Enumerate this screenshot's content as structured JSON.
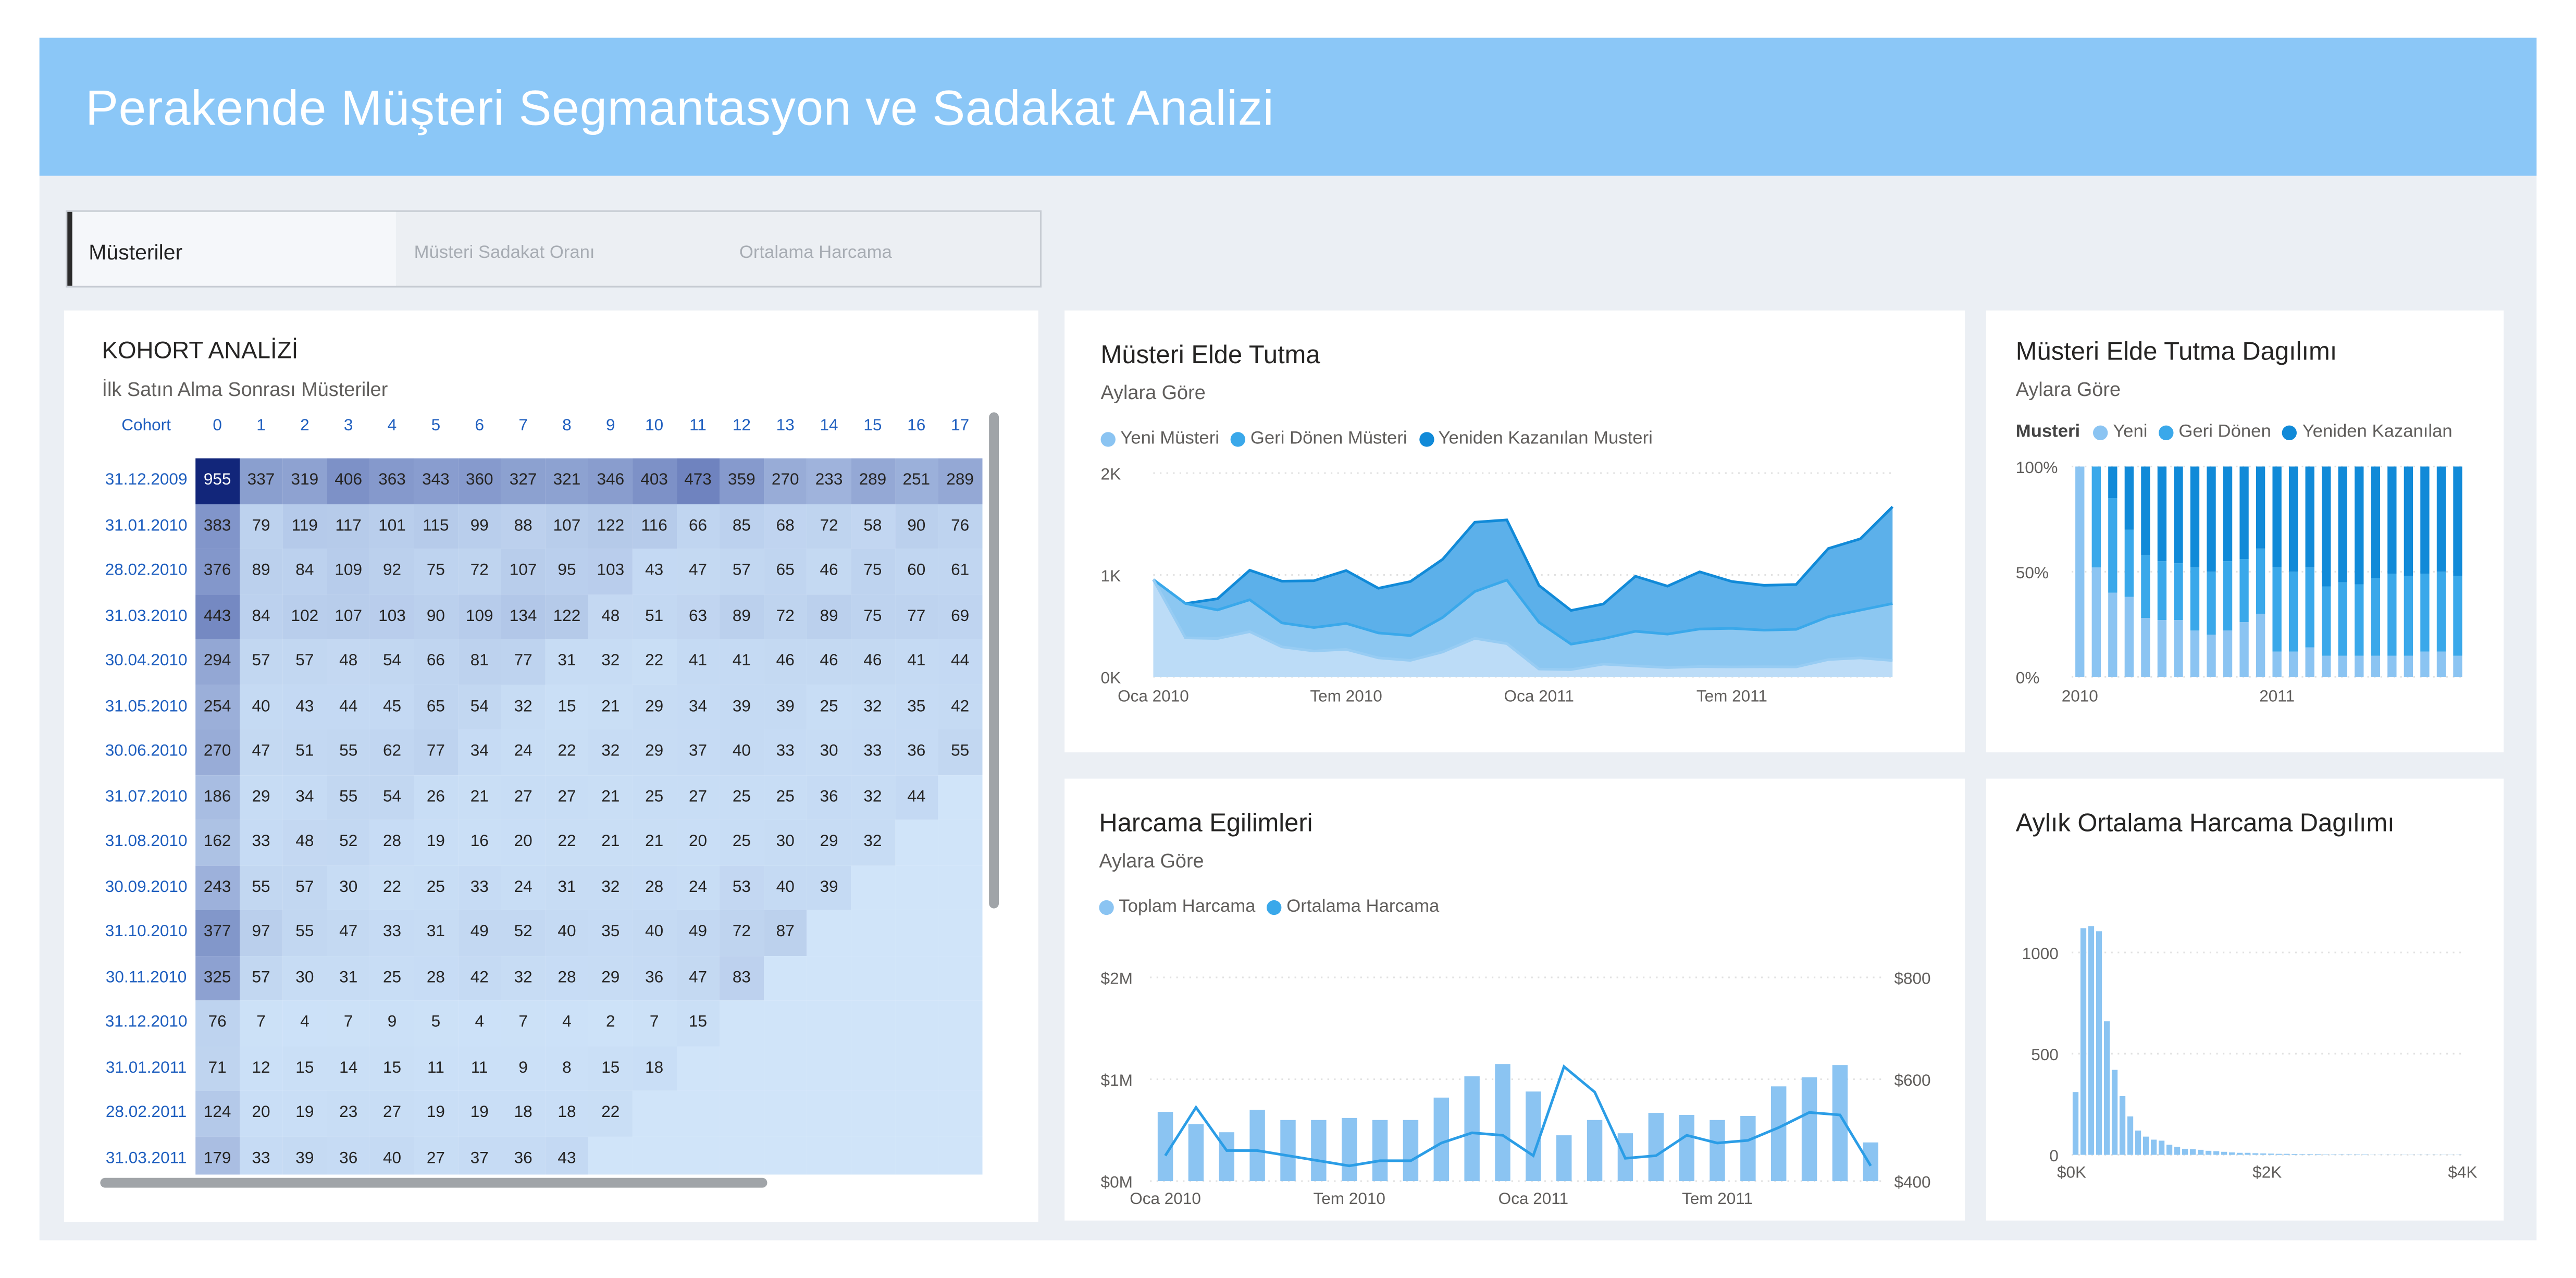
{
  "page": {
    "title": "Perakende Müşteri Segmantasyon ve Sadakat Analizi"
  },
  "tabs": [
    {
      "label": "Müsteriler",
      "active": true
    },
    {
      "label": "Müsteri Sadakat Oranı",
      "active": false
    },
    {
      "label": "Ortalama Harcama",
      "active": false
    }
  ],
  "cohort": {
    "title": "KOHORT ANALİZİ",
    "subtitle": "İlk Satın Alma Sonrası Müsteriler",
    "header_label": "Cohort",
    "periods": [
      "0",
      "1",
      "2",
      "3",
      "4",
      "5",
      "6",
      "7",
      "8",
      "9",
      "10",
      "11",
      "12",
      "13",
      "14",
      "15",
      "16",
      "17"
    ],
    "rows": [
      {
        "cohort": "31.12.2009",
        "values": [
          955,
          337,
          319,
          406,
          363,
          343,
          360,
          327,
          321,
          346,
          403,
          473,
          359,
          270,
          233,
          289,
          251,
          289
        ]
      },
      {
        "cohort": "31.01.2010",
        "values": [
          383,
          79,
          119,
          117,
          101,
          115,
          99,
          88,
          107,
          122,
          116,
          66,
          85,
          68,
          72,
          58,
          90,
          76
        ]
      },
      {
        "cohort": "28.02.2010",
        "values": [
          376,
          89,
          84,
          109,
          92,
          75,
          72,
          107,
          95,
          103,
          43,
          47,
          57,
          65,
          46,
          75,
          60,
          61
        ]
      },
      {
        "cohort": "31.03.2010",
        "values": [
          443,
          84,
          102,
          107,
          103,
          90,
          109,
          134,
          122,
          48,
          51,
          63,
          89,
          72,
          89,
          75,
          77,
          69
        ]
      },
      {
        "cohort": "30.04.2010",
        "values": [
          294,
          57,
          57,
          48,
          54,
          66,
          81,
          77,
          31,
          32,
          22,
          41,
          41,
          46,
          46,
          46,
          41,
          44
        ]
      },
      {
        "cohort": "31.05.2010",
        "values": [
          254,
          40,
          43,
          44,
          45,
          65,
          54,
          32,
          15,
          21,
          29,
          34,
          39,
          39,
          25,
          32,
          35,
          42
        ]
      },
      {
        "cohort": "30.06.2010",
        "values": [
          270,
          47,
          51,
          55,
          62,
          77,
          34,
          24,
          22,
          32,
          29,
          37,
          40,
          33,
          30,
          33,
          36,
          55
        ]
      },
      {
        "cohort": "31.07.2010",
        "values": [
          186,
          29,
          34,
          55,
          54,
          26,
          21,
          27,
          27,
          21,
          25,
          27,
          25,
          25,
          36,
          32,
          44
        ]
      },
      {
        "cohort": "31.08.2010",
        "values": [
          162,
          33,
          48,
          52,
          28,
          19,
          16,
          20,
          22,
          21,
          21,
          20,
          25,
          30,
          29,
          32
        ]
      },
      {
        "cohort": "30.09.2010",
        "values": [
          243,
          55,
          57,
          30,
          22,
          25,
          33,
          24,
          31,
          32,
          28,
          24,
          53,
          40,
          39
        ]
      },
      {
        "cohort": "31.10.2010",
        "values": [
          377,
          97,
          55,
          47,
          33,
          31,
          49,
          52,
          40,
          35,
          40,
          49,
          72,
          87
        ]
      },
      {
        "cohort": "30.11.2010",
        "values": [
          325,
          57,
          30,
          31,
          25,
          28,
          42,
          32,
          28,
          29,
          36,
          47,
          83
        ]
      },
      {
        "cohort": "31.12.2010",
        "values": [
          76,
          7,
          4,
          7,
          9,
          5,
          4,
          7,
          4,
          2,
          7,
          15
        ]
      },
      {
        "cohort": "31.01.2011",
        "values": [
          71,
          12,
          15,
          14,
          15,
          11,
          11,
          9,
          8,
          15,
          18
        ]
      },
      {
        "cohort": "28.02.2011",
        "values": [
          124,
          20,
          19,
          23,
          27,
          19,
          19,
          18,
          18,
          22
        ]
      },
      {
        "cohort": "31.03.2011",
        "values": [
          179,
          33,
          39,
          36,
          40,
          27,
          37,
          36,
          43
        ]
      }
    ]
  },
  "retention": {
    "title": "Müsteri Elde Tutma",
    "subtitle": "Aylara Göre",
    "legend": [
      {
        "label": "Yeni Müsteri",
        "color": "#8bc4f2"
      },
      {
        "label": "Geri Dönen Müsteri",
        "color": "#3aa8ea"
      },
      {
        "label": "Yeniden Kazanılan Musteri",
        "color": "#118ad8"
      }
    ]
  },
  "distribution": {
    "title": "Müsteri Elde Tutma Dagılımı",
    "subtitle": "Aylara Göre",
    "legend_title": "Musteri",
    "legend": [
      {
        "label": "Yeni",
        "color": "#8bc4f2"
      },
      {
        "label": "Geri Dönen",
        "color": "#3aa8ea"
      },
      {
        "label": "Yeniden Kazanılan",
        "color": "#118ad8"
      }
    ]
  },
  "spending": {
    "title": "Harcama Egilimleri",
    "subtitle": "Aylara Göre",
    "legend": [
      {
        "label": "Toplam Harcama",
        "color": "#8bc4f2"
      },
      {
        "label": "Ortalama Harcama",
        "color": "#3aa8ea"
      }
    ]
  },
  "avgdist": {
    "title": "Aylık Ortalama Harcama Dagılımı"
  },
  "chart_data": [
    {
      "type": "area",
      "name": "Müsteri Elde Tutma",
      "x": [
        "Oca 2010",
        "Şub 2010",
        "Mar 2010",
        "Nis 2010",
        "May 2010",
        "Haz 2010",
        "Tem 2010",
        "Ağu 2010",
        "Eyl 2010",
        "Eki 2010",
        "Kas 2010",
        "Ara 2010",
        "Oca 2011",
        "Şub 2011",
        "Mar 2011",
        "Nis 2011",
        "May 2011",
        "Haz 2011",
        "Tem 2011",
        "Ağu 2011",
        "Eyl 2011",
        "Eki 2011",
        "Kas 2011",
        "Ara 2011"
      ],
      "x_tick_labels": [
        "Oca 2010",
        "Tem 2010",
        "Oca 2011",
        "Tem 2011"
      ],
      "series": [
        {
          "name": "Yeni Müsteri",
          "values": [
            955,
            383,
            376,
            443,
            294,
            254,
            270,
            186,
            162,
            243,
            377,
            325,
            76,
            71,
            124,
            107,
            90,
            100,
            96,
            98,
            96,
            170,
            185,
            160
          ]
        },
        {
          "name": "Geri Dönen Müsteri",
          "values": [
            0,
            337,
            280,
            313,
            235,
            230,
            254,
            244,
            243,
            340,
            460,
            625,
            460,
            250,
            250,
            340,
            330,
            370,
            380,
            360,
            370,
            420,
            470,
            560
          ]
        },
        {
          "name": "Yeniden Kazanılan Musteri",
          "values": [
            0,
            0,
            110,
            290,
            410,
            460,
            520,
            440,
            530,
            570,
            680,
            590,
            360,
            330,
            340,
            540,
            470,
            560,
            460,
            440,
            440,
            670,
            700,
            950
          ]
        }
      ],
      "y_tick_labels": [
        "0K",
        "1K",
        "2K"
      ],
      "ylim": [
        0,
        2000
      ]
    },
    {
      "type": "bar",
      "name": "Müsteri Elde Tutma Dagılımı",
      "stacked": "100%",
      "x_tick_labels": [
        "2010",
        "2011"
      ],
      "y_tick_labels": [
        "0%",
        "50%",
        "100%"
      ],
      "series": [
        {
          "name": "Yeni",
          "values": [
            100,
            52,
            40,
            38,
            28,
            27,
            27,
            22,
            20,
            22,
            26,
            30,
            12,
            12,
            14,
            10,
            10,
            10,
            10,
            10,
            10,
            12,
            12,
            10
          ]
        },
        {
          "name": "Geri Dönen",
          "values": [
            0,
            48,
            45,
            32,
            30,
            28,
            27,
            30,
            30,
            33,
            30,
            31,
            40,
            38,
            38,
            33,
            35,
            34,
            37,
            39,
            38,
            37,
            38,
            38
          ]
        },
        {
          "name": "Yeniden Kazanılan",
          "values": [
            0,
            0,
            15,
            30,
            42,
            45,
            46,
            48,
            50,
            45,
            44,
            39,
            48,
            50,
            48,
            57,
            55,
            56,
            53,
            51,
            52,
            51,
            50,
            52
          ]
        }
      ]
    },
    {
      "type": "bar",
      "name": "Harcama Egilimleri",
      "x": [
        "Oca 2010",
        "Şub 2010",
        "Mar 2010",
        "Nis 2010",
        "May 2010",
        "Haz 2010",
        "Tem 2010",
        "Ağu 2010",
        "Eyl 2010",
        "Eki 2010",
        "Kas 2010",
        "Ara 2010",
        "Oca 2011",
        "Şub 2011",
        "Mar 2011",
        "Nis 2011",
        "May 2011",
        "Haz 2011",
        "Tem 2011",
        "Ağu 2011",
        "Eyl 2011",
        "Eki 2011",
        "Kas 2011",
        "Ara 2011"
      ],
      "x_tick_labels": [
        "Oca 2010",
        "Tem 2010",
        "Oca 2011",
        "Tem 2011"
      ],
      "series": [
        {
          "name": "Toplam Harcama",
          "axis": "left",
          "values": [
            0.68,
            0.56,
            0.48,
            0.7,
            0.6,
            0.6,
            0.62,
            0.6,
            0.6,
            0.82,
            1.03,
            1.15,
            0.88,
            0.45,
            0.6,
            0.47,
            0.67,
            0.65,
            0.6,
            0.64,
            0.93,
            1.02,
            1.14,
            0.38
          ]
        },
        {
          "name": "Ortalama Harcama",
          "axis": "right",
          "values": [
            450,
            545,
            460,
            460,
            450,
            440,
            430,
            440,
            440,
            475,
            495,
            490,
            450,
            625,
            575,
            445,
            450,
            490,
            475,
            480,
            505,
            535,
            530,
            430
          ]
        }
      ],
      "y_tick_labels_left": [
        "$0M",
        "$1M",
        "$2M"
      ],
      "y_tick_labels_right": [
        "$400",
        "$600",
        "$800"
      ],
      "ylim_left": [
        0,
        2
      ],
      "ylim_right": [
        400,
        800
      ]
    },
    {
      "type": "bar",
      "name": "Aylık Ortalama Harcama Dagılımı",
      "x_tick_labels": [
        "$0K",
        "$2K",
        "$4K"
      ],
      "y_tick_labels": [
        "0",
        "500",
        "1000"
      ],
      "xlim": [
        0,
        4000
      ],
      "ylim": [
        0,
        1250
      ],
      "bin_width": 80,
      "values": [
        310,
        1120,
        1130,
        1105,
        660,
        420,
        290,
        190,
        120,
        90,
        75,
        70,
        50,
        40,
        30,
        28,
        25,
        20,
        18,
        15,
        12,
        10,
        10,
        8,
        7,
        6,
        5,
        5,
        4,
        3,
        3,
        3,
        2,
        2,
        2,
        2,
        2,
        2,
        1,
        1,
        1,
        1,
        1,
        1,
        1,
        1,
        1,
        1,
        1,
        1
      ]
    }
  ]
}
